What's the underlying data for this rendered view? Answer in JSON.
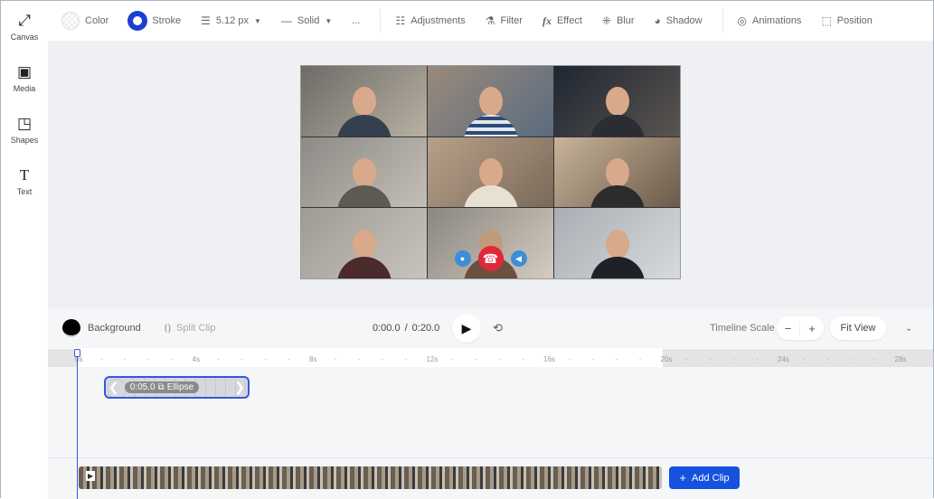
{
  "sidebar": {
    "items": [
      {
        "label": "Canvas",
        "icon": "expand-icon"
      },
      {
        "label": "Media",
        "icon": "media-icon"
      },
      {
        "label": "Shapes",
        "icon": "shapes-icon"
      },
      {
        "label": "Text",
        "icon": "text-icon"
      }
    ]
  },
  "toolbar": {
    "color": "Color",
    "stroke": "Stroke",
    "stroke_width": "5.12 px",
    "stroke_style": "Solid",
    "more": "...",
    "adjustments": "Adjustments",
    "filter": "Filter",
    "effect": "Effect",
    "blur": "Blur",
    "shadow": "Shadow",
    "animations": "Animations",
    "position": "Position"
  },
  "colors": {
    "accent": "#1652e0",
    "stroke": "#1b3fcf",
    "hangup": "#e0283a"
  },
  "controls": {
    "background": "Background",
    "split_clip": "Split Clip",
    "current_time": "0:00.0",
    "separator": "/",
    "total_time": "0:20.0",
    "timeline_scale": "Timeline Scale",
    "minus": "−",
    "plus": "+",
    "fit_view": "Fit View"
  },
  "ruler": {
    "ticks": [
      "0s",
      "4s",
      "8s",
      "12s",
      "16s",
      "20s",
      "24s",
      "28s"
    ]
  },
  "clip": {
    "time": "0:05.0",
    "label": "Ellipse"
  },
  "bottom": {
    "add_clip": "Add Clip"
  }
}
